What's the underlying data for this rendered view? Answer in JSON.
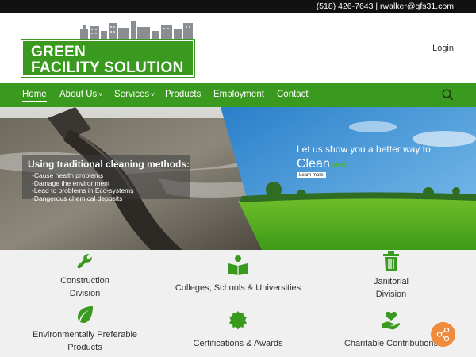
{
  "topbar": {
    "contact": "(518) 426-7643 | rwalker@gfs31.com"
  },
  "logo": {
    "line1": "GREEN",
    "line2": "FACILITY SOLUTION"
  },
  "header": {
    "login": "Login"
  },
  "nav": {
    "items": [
      {
        "label": "Home",
        "active": true
      },
      {
        "label": "About Us",
        "has_caret": true
      },
      {
        "label": "Services",
        "has_caret": true
      },
      {
        "label": "Products"
      },
      {
        "label": "Employment"
      },
      {
        "label": "Contact"
      }
    ],
    "caret": "˅",
    "search_icon": "search-icon"
  },
  "hero": {
    "left": {
      "title": "Using traditional cleaning methods:",
      "items": [
        "-Cause health problems",
        "-Damage the environment",
        "-Lead to problems in Eco-systems",
        "-Dangerous chemical deposits"
      ]
    },
    "right": {
      "title": "Let us show you a better way to",
      "clean": "Clean",
      "green": "Green",
      "button": "Learn more"
    }
  },
  "services": [
    {
      "lines": [
        "Construction",
        "Division"
      ],
      "icon": "wrench-icon"
    },
    {
      "lines": [
        "Colleges, Schools & Universities"
      ],
      "icon": "reading-person-icon"
    },
    {
      "lines": [
        "Janitorial",
        "Division"
      ],
      "icon": "trash-icon"
    },
    {
      "lines": [
        "Environmentally Preferable",
        "Products"
      ],
      "icon": "leaf-icon"
    },
    {
      "lines": [
        "Certifications & Awards"
      ],
      "icon": "award-badge-icon"
    },
    {
      "lines": [
        "Charitable Contributions"
      ],
      "icon": "hand-heart-icon"
    }
  ],
  "colors": {
    "brand_green": "#3a9a1f",
    "topbar": "#111111",
    "share_orange": "#f08a3c",
    "services_bg": "#f0f0f1"
  },
  "share": {
    "icon": "share-icon"
  }
}
